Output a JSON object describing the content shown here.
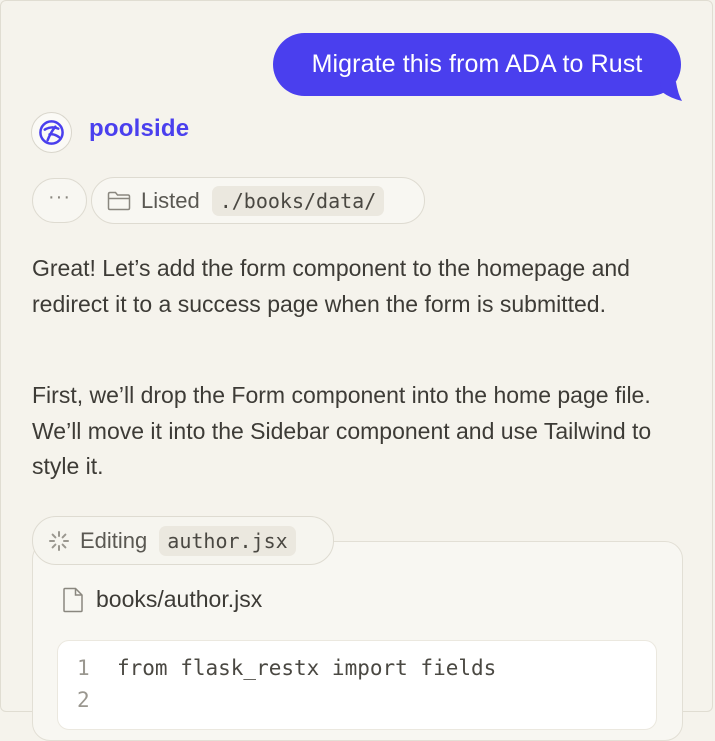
{
  "user_message": "Migrate this from ADA to Rust",
  "assistant": {
    "name": "poolside",
    "avatar_icon": "poolside-logo-icon"
  },
  "tool_calls": {
    "more_label": "···",
    "listed": {
      "label": "Listed",
      "path": "./books/data/",
      "icon": "folder-icon"
    },
    "editing": {
      "label": "Editing",
      "file": "author.jsx",
      "icon": "spinner-icon"
    }
  },
  "paragraphs": [
    "Great! Let’s add the form component to the homepage and redirect it to a success page when the form is submitted.",
    "First, we’ll drop the Form component into the home page file. We’ll move it into the Sidebar component and use Tailwind to style it."
  ],
  "editor": {
    "file_path": "books/author.jsx",
    "file_icon": "file-icon",
    "lines": [
      {
        "num": "1",
        "code": "from flask_restx import fields"
      },
      {
        "num": "2",
        "code": ""
      }
    ]
  },
  "colors": {
    "accent": "#4a3fee",
    "background": "#f5f3ec",
    "text": "#3d3b36"
  }
}
